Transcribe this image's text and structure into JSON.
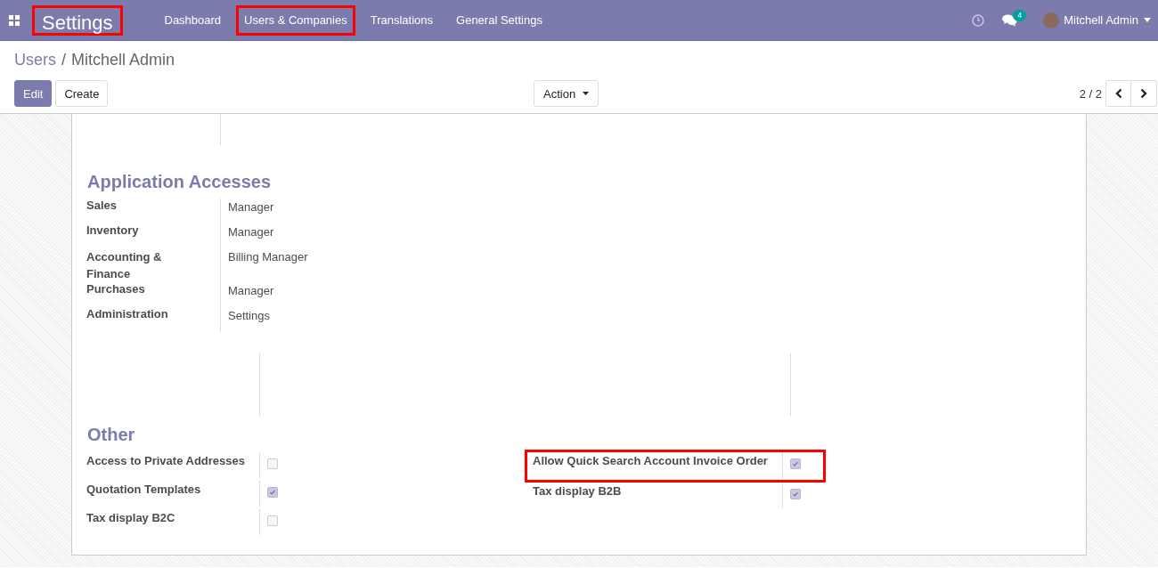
{
  "navbar": {
    "app_title": "Settings",
    "app_title_highlighted": true,
    "menu": [
      {
        "label": "Dashboard",
        "highlighted": false
      },
      {
        "label": "Users & Companies",
        "highlighted": true
      },
      {
        "label": "Translations",
        "highlighted": false
      },
      {
        "label": "General Settings",
        "highlighted": false
      }
    ],
    "messages_count": "4",
    "user_name": "Mitchell Admin"
  },
  "breadcrumb": [
    "Users",
    "Mitchell Admin"
  ],
  "breadcrumb_separator": "/",
  "buttons": {
    "edit": "Edit",
    "create": "Create",
    "action": "Action"
  },
  "pager": "2 / 2",
  "application_accesses": {
    "title": "Application Accesses",
    "rows": [
      {
        "label": "Sales",
        "value": "Manager"
      },
      {
        "label": "Inventory",
        "value": "Manager"
      },
      {
        "label": "Accounting & Finance",
        "value": "Billing Manager"
      },
      {
        "label": "Purchases",
        "value": "Manager"
      },
      {
        "label": "Administration",
        "value": "Settings"
      }
    ]
  },
  "other": {
    "title": "Other",
    "left": [
      {
        "label": "Access to Private Addresses",
        "checked": false,
        "highlighted": false
      },
      {
        "label": "Quotation Templates",
        "checked": true,
        "highlighted": false
      },
      {
        "label": "Tax display B2C",
        "checked": false,
        "highlighted": false
      }
    ],
    "right": [
      {
        "label": "Allow Quick Search Account Invoice Order",
        "checked": true,
        "highlighted": true
      },
      {
        "label": "Tax display B2B",
        "checked": true,
        "highlighted": false
      }
    ]
  }
}
